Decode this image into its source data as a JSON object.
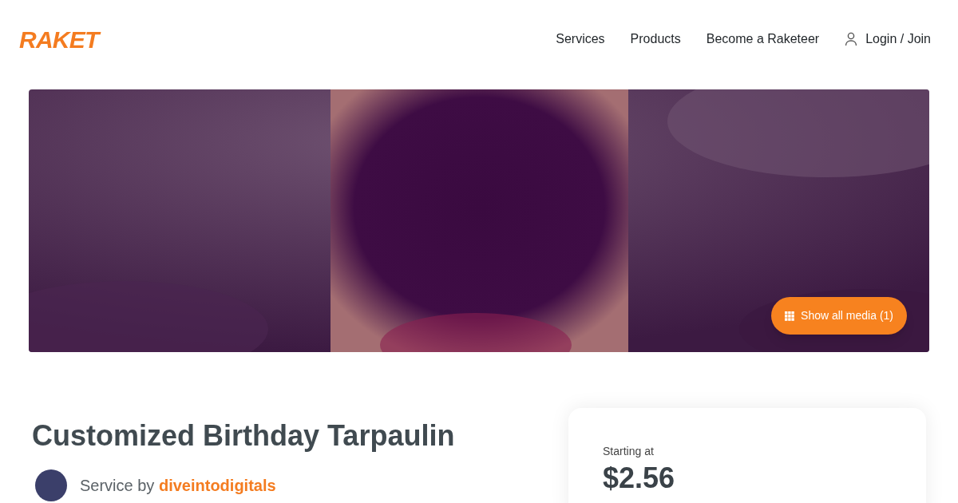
{
  "logo": "RAKET",
  "nav": [
    {
      "label": "Services"
    },
    {
      "label": "Products"
    },
    {
      "label": "Become a Raketeer"
    },
    {
      "label": "Login / Join"
    }
  ],
  "gallery": {
    "kind": "picture",
    "button": "Show all media (1)"
  },
  "service": {
    "title": "Customized Birthday Tarpaulin",
    "by_label": "Service by",
    "seller": "diveintodigitals"
  },
  "price_card": {
    "label": "Starting at",
    "price": "$2.56"
  }
}
